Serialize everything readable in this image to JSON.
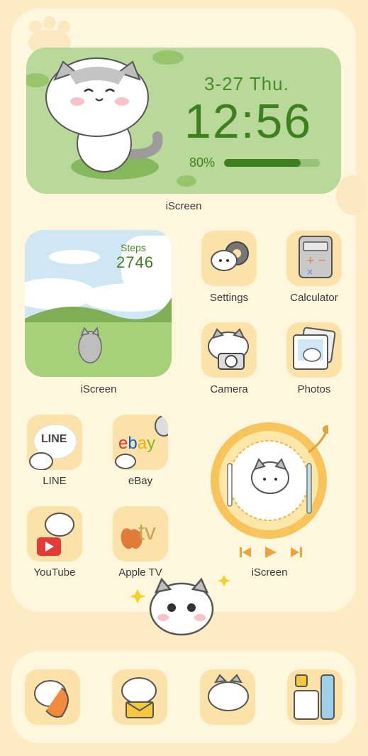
{
  "clock_widget": {
    "date": "3-27  Thu.",
    "time": "12:56",
    "battery_percent_text": "80%",
    "battery_level": 0.8,
    "label": "iScreen"
  },
  "steps_widget": {
    "title": "Steps",
    "value": "2746",
    "label": "iScreen"
  },
  "apps": {
    "settings": "Settings",
    "calculator": "Calculator",
    "camera": "Camera",
    "photos": "Photos",
    "line": "LINE",
    "line_logo": "LINE",
    "ebay": "eBay",
    "youtube": "YouTube",
    "appletv": "Apple TV",
    "appletv_logo": "tv"
  },
  "plate_widget": {
    "label": "iScreen"
  },
  "dock": {
    "items": [
      "phone-icon",
      "mail-icon",
      "messages-icon",
      "app-store-icon"
    ]
  },
  "colors": {
    "background": "#fdebc6",
    "panel": "#fef6dd",
    "widget_green": "#b9d99a",
    "text_green": "#3f7f20",
    "icon_tile": "#fbe2a8"
  }
}
